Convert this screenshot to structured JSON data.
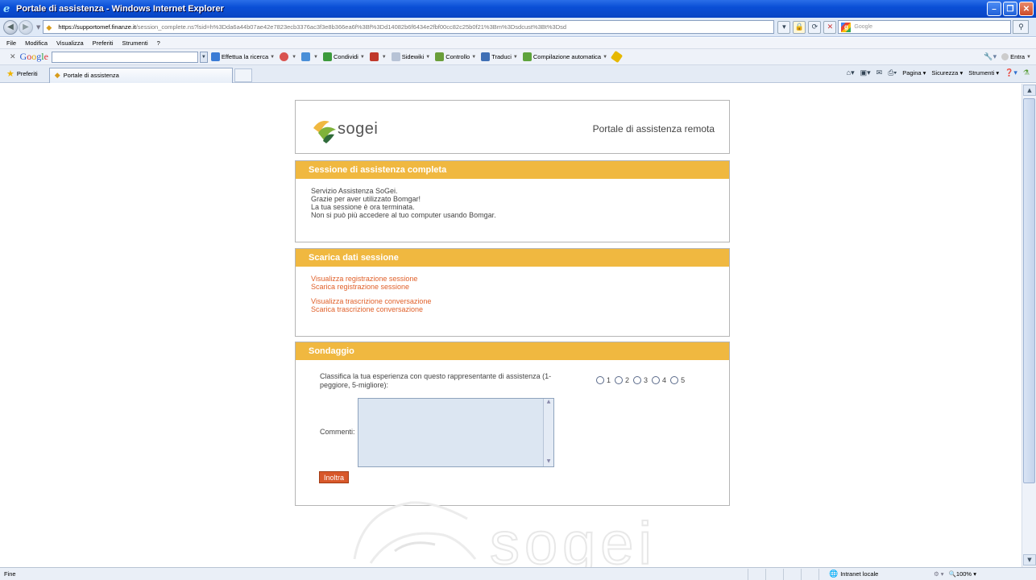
{
  "window": {
    "title": "Portale di assistenza - Windows Internet Explorer"
  },
  "address": {
    "host": "https://supportomef.finanze.it",
    "path": "/session_complete.ns?lsid=h%3Dda6a44b07ae42e7823ecb3376ac3f3e8b366ea6f%3Bf%3Dd14082b6f6434e2fbf00cc82c25b0f21%3Bm%3Dsdcust%3Bt%3Dsd",
    "search_placeholder": "Google"
  },
  "menu": [
    "File",
    "Modifica",
    "Visualizza",
    "Preferiti",
    "Strumenti",
    "?"
  ],
  "google_toolbar": {
    "logo": "Google",
    "items": [
      {
        "label": "Effettua la ricerca",
        "icon": "google-search-icon",
        "color": "#3a7bd5"
      },
      {
        "label": "",
        "icon": "popup-blocker-icon",
        "color": "#d9534f"
      },
      {
        "label": "",
        "icon": "plus-icon",
        "color": "#4a8fd8"
      },
      {
        "label": "Condividi",
        "icon": "share-icon",
        "color": "#3c9a3c"
      },
      {
        "label": "",
        "icon": "notes-icon",
        "color": "#c0392b"
      },
      {
        "label": "Sidewiki",
        "icon": "sidewiki-icon",
        "color": "#7a8ba6"
      },
      {
        "label": "Controllo",
        "icon": "spellcheck-icon",
        "color": "#6a9e3a"
      },
      {
        "label": "Traduci",
        "icon": "translate-icon",
        "color": "#3f6fb5"
      },
      {
        "label": "Compilazione automatica",
        "icon": "autofill-icon",
        "color": "#5ea33c"
      }
    ],
    "signin": "Entra"
  },
  "favorites": {
    "label": "Preferiti",
    "tab_title": "Portale di assistenza"
  },
  "commandbar": [
    "Pagina",
    "Sicurezza",
    "Strumenti"
  ],
  "page": {
    "header_subtitle": "Portale di assistenza remota",
    "logo_text": "sogei",
    "session": {
      "title": "Sessione di assistenza completa",
      "lines": [
        "Servizio Assistenza SoGei.",
        "Grazie per aver utilizzato Bomgar!",
        "La tua sessione è ora terminata.",
        "Non si può più accedere al tuo computer usando Bomgar."
      ]
    },
    "download": {
      "title": "Scarica dati sessione",
      "links": [
        "Visualizza registrazione sessione",
        "Scarica registrazione sessione",
        "Visualizza trascrizione conversazione",
        "Scarica trascrizione conversazione"
      ]
    },
    "survey": {
      "title": "Sondaggio",
      "question": "Classifica la tua esperienza con questo rappresentante di assistenza (1-peggiore, 5-migliore):",
      "ratings": [
        "1",
        "2",
        "3",
        "4",
        "5"
      ],
      "comments_label": "Commenti:",
      "submit": "Inoltra"
    },
    "watermark": "sogei"
  },
  "status": {
    "text": "Fine",
    "zone": "Intranet locale",
    "zoom": "100%"
  }
}
